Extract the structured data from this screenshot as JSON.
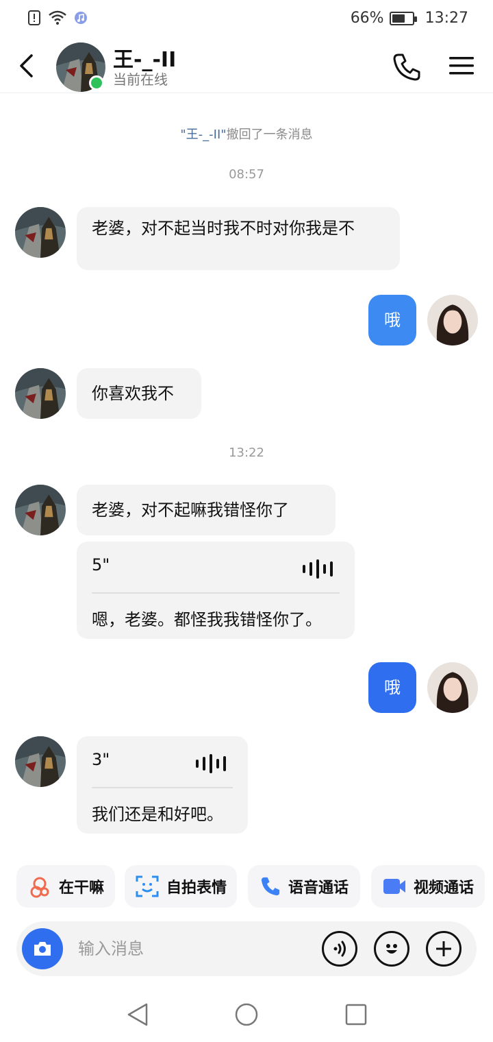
{
  "status_bar": {
    "battery_percent": "66%",
    "battery_level": 0.66,
    "time": "13:27"
  },
  "header": {
    "contact_name": "王-_-II",
    "status": "当前在线"
  },
  "chat": {
    "system_message": {
      "name": "\"王-_-II\"",
      "text": "撤回了一条消息"
    },
    "time_1": "08:57",
    "msg_1": "老婆，对不起当时我不时对你我是不",
    "msg_2": "哦",
    "msg_3": "你喜欢我不",
    "time_2": "13:22",
    "msg_4": "老婆，对不起嘛我错怪你了",
    "voice_1": {
      "duration": "5\"",
      "transcript": "嗯，老婆。都怪我我错怪你了。"
    },
    "msg_5": "哦",
    "voice_2": {
      "duration": "3\"",
      "transcript": "我们还是和好吧。"
    }
  },
  "quick_actions": [
    {
      "label": "在干嘛",
      "icon": "hi-sticker-icon",
      "color": "#f06a4d"
    },
    {
      "label": "自拍表情",
      "icon": "face-scan-icon",
      "color": "#2b8ef0"
    },
    {
      "label": "语音通话",
      "icon": "phone-icon",
      "color": "#3b82f6"
    },
    {
      "label": "视频通话",
      "icon": "video-camera-icon",
      "color": "#4a7cf5"
    }
  ],
  "input": {
    "placeholder": "输入消息"
  },
  "colors": {
    "accent": "#2f6fef",
    "my_bubble": "#3d8bf2",
    "online": "#2fc25b"
  }
}
